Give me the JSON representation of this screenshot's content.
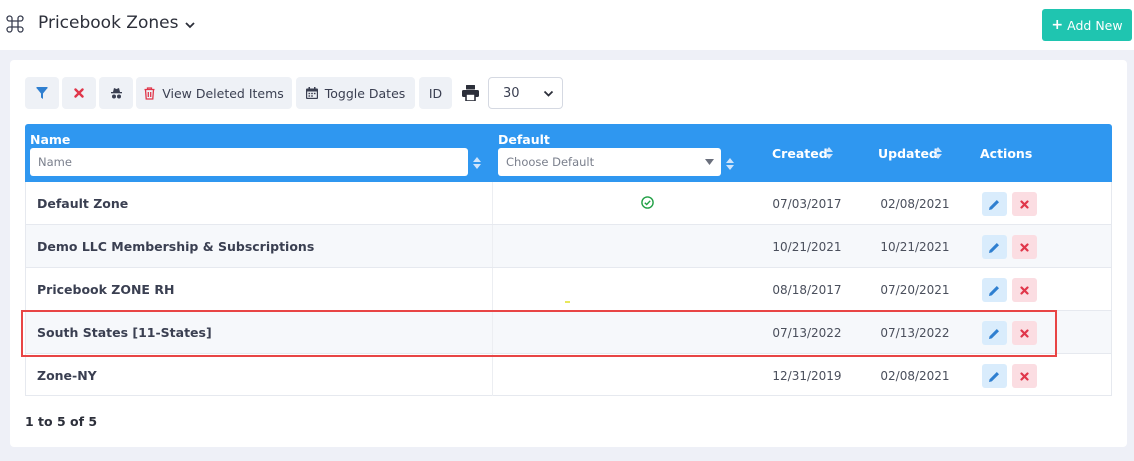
{
  "header": {
    "title": "Pricebook Zones",
    "add_button_label": "Add New",
    "accent_color": "#1fc5b0"
  },
  "toolbar": {
    "view_deleted_label": "View Deleted Items",
    "toggle_dates_label": "Toggle Dates",
    "id_label": "ID",
    "page_size": "30",
    "icons": [
      "filter-icon",
      "clear-filter-icon",
      "incognito-icon",
      "trash-icon",
      "calendar-icon",
      "print-icon"
    ]
  },
  "table": {
    "header_color": "#2f97f0",
    "columns": {
      "name": "Name",
      "default": "Default",
      "created": "Created",
      "updated": "Updated",
      "actions": "Actions"
    },
    "filters": {
      "name_placeholder": "Name",
      "default_placeholder": "Choose Default"
    },
    "rows": [
      {
        "name": "Default Zone",
        "is_default": true,
        "created": "07/03/2017",
        "updated": "02/08/2021"
      },
      {
        "name": "Demo LLC Membership & Subscriptions",
        "is_default": false,
        "created": "10/21/2021",
        "updated": "10/21/2021"
      },
      {
        "name": "Pricebook ZONE RH",
        "is_default": false,
        "created": "08/18/2017",
        "updated": "07/20/2021"
      },
      {
        "name": "South States [11-States]",
        "is_default": false,
        "created": "07/13/2022",
        "updated": "07/13/2022"
      },
      {
        "name": "Zone-NY",
        "is_default": false,
        "created": "12/31/2019",
        "updated": "02/08/2021"
      }
    ]
  },
  "pagination": {
    "summary": "1 to 5 of 5"
  }
}
